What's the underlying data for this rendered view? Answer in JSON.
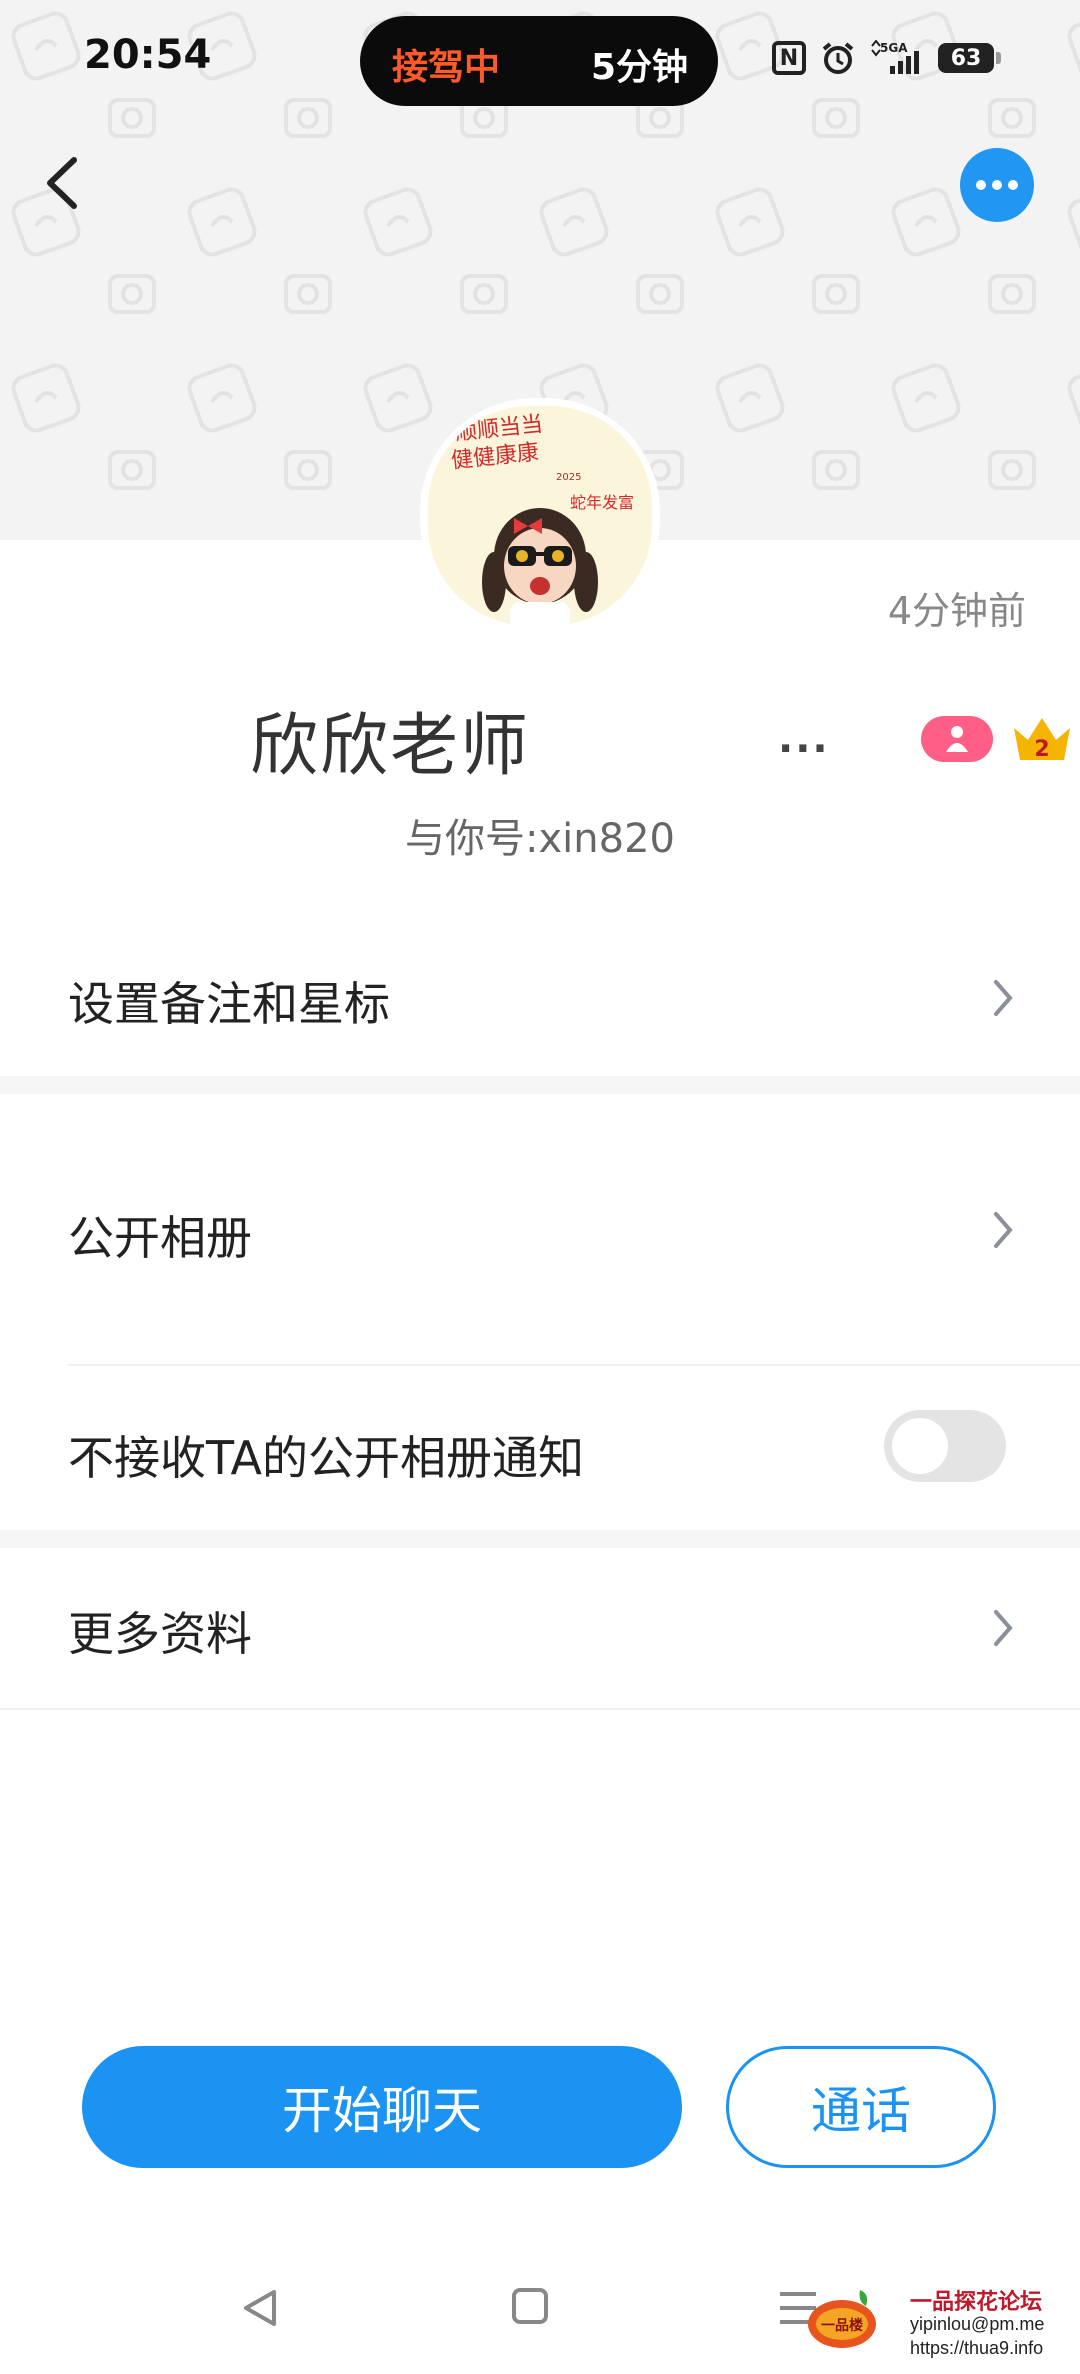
{
  "status_bar": {
    "time": "20:54",
    "pill_left": "接驾中",
    "pill_right": "5分钟",
    "battery": "63",
    "signal_label": "5GA"
  },
  "profile": {
    "last_seen": "4分钟前",
    "name": "欣欣老师",
    "name_dots": "...",
    "account": "与你号:xin820",
    "crown_level": "2",
    "avatar_caption_1": "顺顺当当",
    "avatar_caption_2": "健健康康",
    "avatar_caption_3": "蛇年发富",
    "avatar_year": "2025"
  },
  "menu": {
    "remark": "设置备注和星标",
    "album": "公开相册",
    "no_notify": "不接收TA的公开相册通知",
    "no_notify_enabled": false,
    "more_info": "更多资料"
  },
  "actions": {
    "start_chat": "开始聊天",
    "call": "通话"
  },
  "watermark": {
    "logo_text": "一品楼",
    "title": "一品探花论坛",
    "email": "yipinlou@pm.me",
    "url": "https://thua9.info"
  },
  "colors": {
    "accent": "#1a93f3",
    "pill_text": "#ff5a2a",
    "badge_pink": "#ff5f86",
    "crown": "#f5b400"
  }
}
